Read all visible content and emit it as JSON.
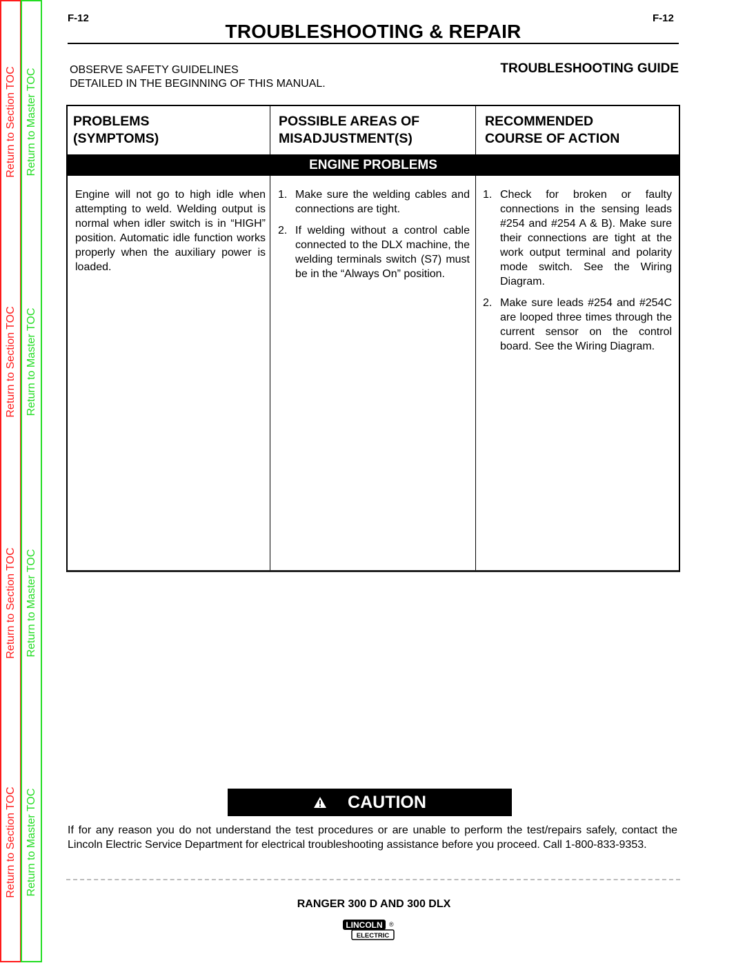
{
  "toc": {
    "section_label": "Return to Section TOC",
    "master_label": "Return to Master TOC",
    "section_color": "#ff1a1a",
    "master_color": "#22dd22"
  },
  "header": {
    "page_code_left": "F-12",
    "page_code_right": "F-12",
    "title": "TROUBLESHOOTING & REPAIR",
    "safety_line1": "OBSERVE SAFETY GUIDELINES",
    "safety_line2": "DETAILED IN THE BEGINNING OF THIS MANUAL.",
    "guide_title": "TROUBLESHOOTING GUIDE"
  },
  "table": {
    "columns": [
      {
        "line1": "PROBLEMS",
        "line2": "(SYMPTOMS)"
      },
      {
        "line1": "POSSIBLE AREAS OF",
        "line2": "MISADJUSTMENT(S)"
      },
      {
        "line1": "RECOMMENDED",
        "line2": "COURSE OF ACTION"
      }
    ],
    "section_band": "ENGINE PROBLEMS",
    "rows": [
      {
        "symptom": "Engine will not go to high idle when attempting to weld.  Welding output is normal when idler switch is in “HIGH” position.  Automatic idle function works properly when the auxiliary power is loaded.",
        "misadjustments": [
          {
            "num": "1.",
            "text": "Make sure the welding cables and connections are tight."
          },
          {
            "num": "2.",
            "text": "If welding without a control cable connected to the DLX machine, the welding terminals switch (S7) must be in the “Always On” position."
          }
        ],
        "actions": [
          {
            "num": "1.",
            "text": "Check for broken or faulty connections in the sensing leads #254 and #254 A & B).  Make sure their connections are tight at the work output terminal and polarity mode switch.  See the Wiring Diagram."
          },
          {
            "num": "2.",
            "text": "Make sure leads #254 and #254C are looped three times through the current sensor on the control board.  See the Wiring Diagram."
          }
        ]
      }
    ]
  },
  "caution": {
    "icon": "warning-triangle-icon",
    "label": "CAUTION",
    "text": "If for any reason you do not understand the test procedures or are unable to perform the test/repairs safely, contact the Lincoln Electric Service Department for electrical troubleshooting assistance before you proceed.  Call 1-800-833-9353."
  },
  "footer": {
    "model": "RANGER 300 D AND 300 DLX",
    "logo_top": "LINCOLN",
    "logo_bottom": "ELECTRIC",
    "logo_mark": "®"
  }
}
